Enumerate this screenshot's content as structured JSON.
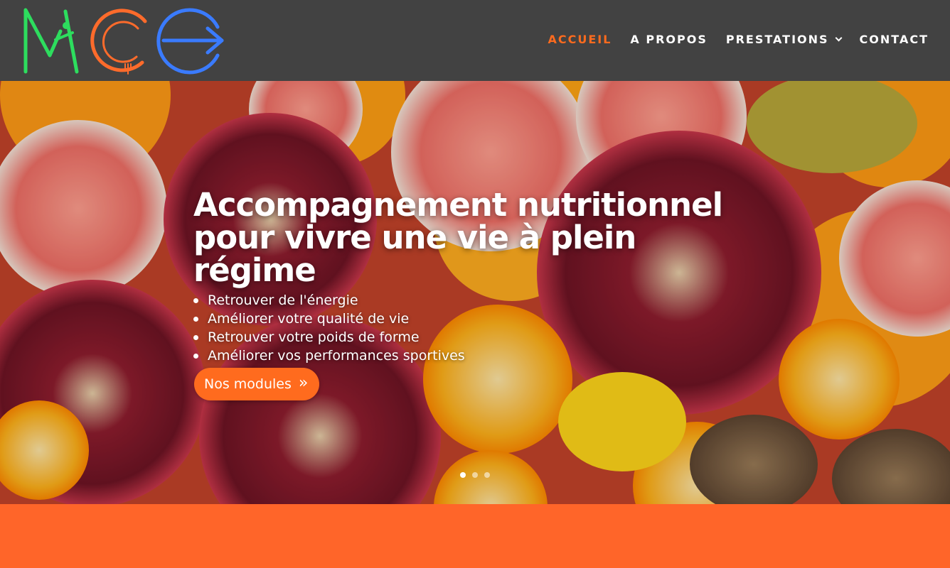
{
  "brand": {
    "logo_alt": "MCE"
  },
  "nav": {
    "items": [
      {
        "label": "ACCUEIL",
        "active": true,
        "has_dropdown": false
      },
      {
        "label": "A PROPOS",
        "active": false,
        "has_dropdown": false
      },
      {
        "label": "PRESTATIONS",
        "active": false,
        "has_dropdown": true
      },
      {
        "label": "CONTACT",
        "active": false,
        "has_dropdown": false
      }
    ]
  },
  "hero": {
    "title_line1": "Accompagnement nutritionnel",
    "title_line2": "pour vivre une vie à plein régime",
    "bullets": [
      "Retrouver de l'énergie",
      "Améliorer votre qualité de vie",
      "Retrouver votre poids de forme",
      "Améliorer vos performances sportives"
    ],
    "cta_label": "Nos modules",
    "cta_icon": "chevron-double-right-icon",
    "slider_dots": 3,
    "active_dot": 1
  },
  "colors": {
    "header_bg": "#424242",
    "accent_orange": "#ff6b1e",
    "band_orange": "#ff6529",
    "logo_green": "#2ddd5e",
    "logo_orange": "#ff6b2b",
    "logo_blue": "#3a7bff"
  }
}
